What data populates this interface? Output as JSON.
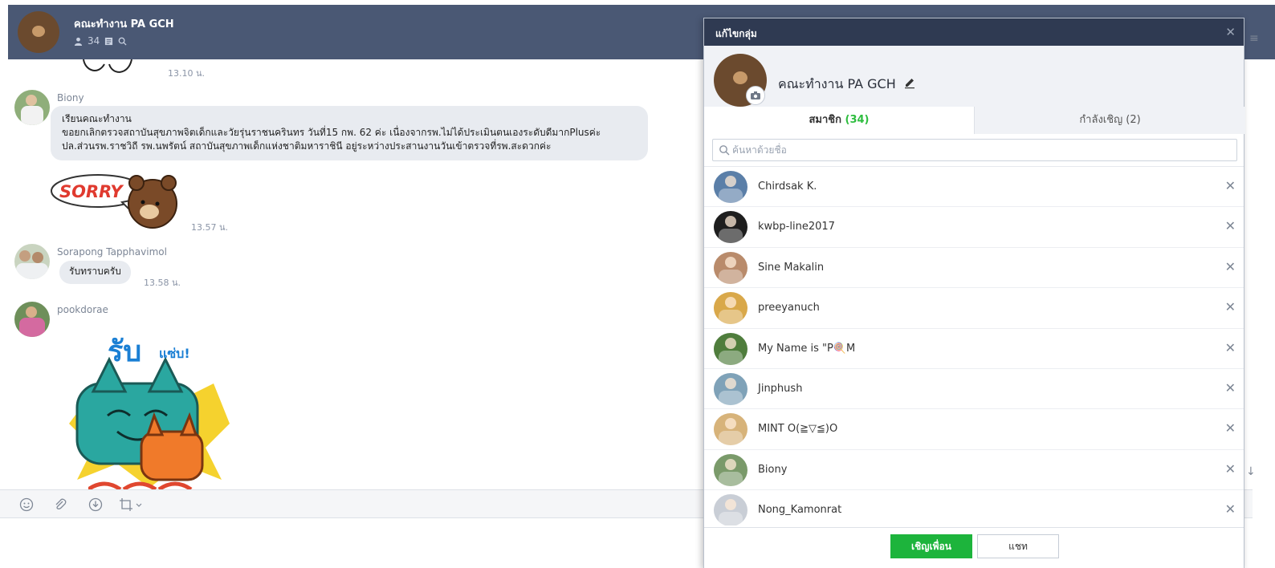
{
  "header": {
    "group_name": "คณะทำงาน PA GCH",
    "member_count": "34"
  },
  "chat": {
    "messages": [
      {
        "time": "13.10 น."
      },
      {
        "sender": "Biony",
        "lines": [
          "เรียนคณะทำงาน",
          "ขอยกเลิกตรวจสถาบันสุขภาพจิตเด็กและวัยรุ่นราชนครินทร วันที่15 กพ. 62 ค่ะ เนื่องจากรพ.ไม่ได้ประเมินตนเองระดับดีมากPlusค่ะ",
          "ปล.ส่วนรพ.ราชวิถี รพ.นพรัตน์ สถาบันสุขภาพเด็กแห่งชาติมหาราชินี อยู่ระหว่างประสานงานวันเข้าตรวจที่รพ.สะดวกค่ะ"
        ]
      },
      {
        "sticker_text": "SORRY",
        "time": "13.57 น."
      },
      {
        "sender": "Sorapong Tapphavimol",
        "text": "รับทราบครับ",
        "time": "13.58 น."
      },
      {
        "sender": "pookdorae",
        "sticker_text_1": "รับ",
        "sticker_text_2": "แซ่บ!"
      }
    ]
  },
  "modal": {
    "title": "แก้ไขกลุ่ม",
    "group_name": "คณะทำงาน PA GCH",
    "tabs": {
      "members_label": "สมาชิก",
      "members_count": "(34)",
      "invites_label": "กำลังเชิญ (2)"
    },
    "search_placeholder": "ค้นหาด้วยชื่อ",
    "members": [
      {
        "name": "Chirdsak K.",
        "color": "#5b7fa8"
      },
      {
        "name": "kwbp-line2017",
        "color": "#1e1e1e"
      },
      {
        "name": "Sine Makalin",
        "color": "#b98b6b"
      },
      {
        "name": "preeyanuch",
        "color": "#d9a84a"
      },
      {
        "name": "My Name is \"P🍭M",
        "color": "#4f7d3c"
      },
      {
        "name": "Jinphush",
        "color": "#7fa2b8"
      },
      {
        "name": "MINT  O(≧▽≦)O",
        "color": "#d7b37a"
      },
      {
        "name": "Biony",
        "color": "#7a9a6a"
      },
      {
        "name": "Nong_Kamonrat",
        "color": "#c9ced6"
      }
    ],
    "invite_button": "เชิญเพื่อน",
    "chat_button": "แชท"
  },
  "colors": {
    "header_bg": "#4a5874",
    "modal_bar_bg": "#2f3a52",
    "accent_green": "#1db43c"
  }
}
